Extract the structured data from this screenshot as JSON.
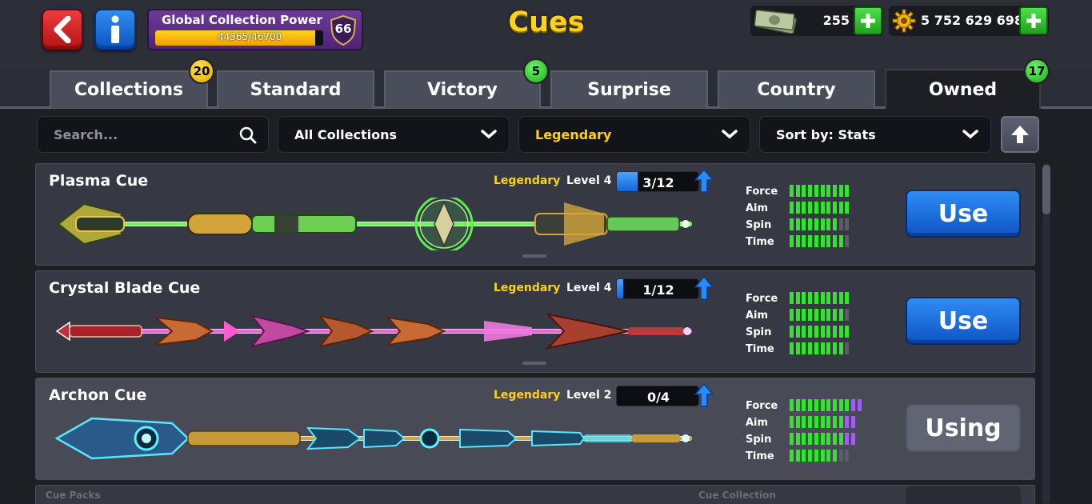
{
  "header": {
    "title": "Cues",
    "back_icon": "back-arrow-icon",
    "info_icon": "info-icon",
    "global_power": {
      "label": "Global Collection Power",
      "progress_text": "44365/46700",
      "progress_fraction": 0.95,
      "level": "66"
    },
    "cash": "255",
    "coins": "5 752 629 698"
  },
  "tabs": [
    {
      "label": "Collections",
      "badge": "20",
      "badge_color": "yellow",
      "active": false
    },
    {
      "label": "Standard",
      "badge": "",
      "active": false
    },
    {
      "label": "Victory",
      "badge": "5",
      "badge_color": "green",
      "active": false
    },
    {
      "label": "Surprise",
      "badge": "",
      "active": false
    },
    {
      "label": "Country",
      "badge": "",
      "active": false
    },
    {
      "label": "Owned",
      "badge": "17",
      "badge_color": "green",
      "active": true
    }
  ],
  "filters": {
    "search_placeholder": "Search...",
    "collection": "All Collections",
    "rarity": "Legendary",
    "sort": "Sort by: Stats"
  },
  "stat_labels": [
    "Force",
    "Aim",
    "Spin",
    "Time"
  ],
  "cues": [
    {
      "name": "Plasma Cue",
      "rarity": "Legendary",
      "level": "Level 4",
      "progress": "3/12",
      "progress_fraction": 0.25,
      "stats": [
        {
          "green": 10,
          "gray": 0,
          "purple": 0,
          "total": 10
        },
        {
          "green": 10,
          "gray": 0,
          "purple": 0,
          "total": 10
        },
        {
          "green": 8,
          "gray": 2,
          "purple": 0,
          "total": 10
        },
        {
          "green": 9,
          "gray": 1,
          "purple": 0,
          "total": 10
        }
      ],
      "button": "Use",
      "in_use": false
    },
    {
      "name": "Crystal Blade Cue",
      "rarity": "Legendary",
      "level": "Level 4",
      "progress": "1/12",
      "progress_fraction": 0.08,
      "stats": [
        {
          "green": 10,
          "gray": 0,
          "purple": 0,
          "total": 10
        },
        {
          "green": 9,
          "gray": 1,
          "purple": 0,
          "total": 10
        },
        {
          "green": 10,
          "gray": 0,
          "purple": 0,
          "total": 10
        },
        {
          "green": 9,
          "gray": 1,
          "purple": 0,
          "total": 10
        }
      ],
      "button": "Use",
      "in_use": false
    },
    {
      "name": "Archon Cue",
      "rarity": "Legendary",
      "level": "Level 2",
      "progress": "0/4",
      "progress_fraction": 0,
      "stats": [
        {
          "green": 10,
          "gray": 0,
          "purple": 2,
          "total": 12
        },
        {
          "green": 9,
          "gray": 0,
          "purple": 2,
          "total": 11
        },
        {
          "green": 9,
          "gray": 0,
          "purple": 2,
          "total": 11
        },
        {
          "green": 8,
          "gray": 2,
          "purple": 0,
          "total": 10
        }
      ],
      "button": "Using",
      "in_use": true
    }
  ],
  "footer": {
    "left": "Cue Packs",
    "right": "Cue Collection"
  },
  "colors": {
    "accent_yellow": "#ffd21a",
    "stat_green": "#2fe62a",
    "stat_gray": "#5b5d66",
    "stat_purple": "#a35cf0",
    "button_blue": "#1565d8"
  }
}
